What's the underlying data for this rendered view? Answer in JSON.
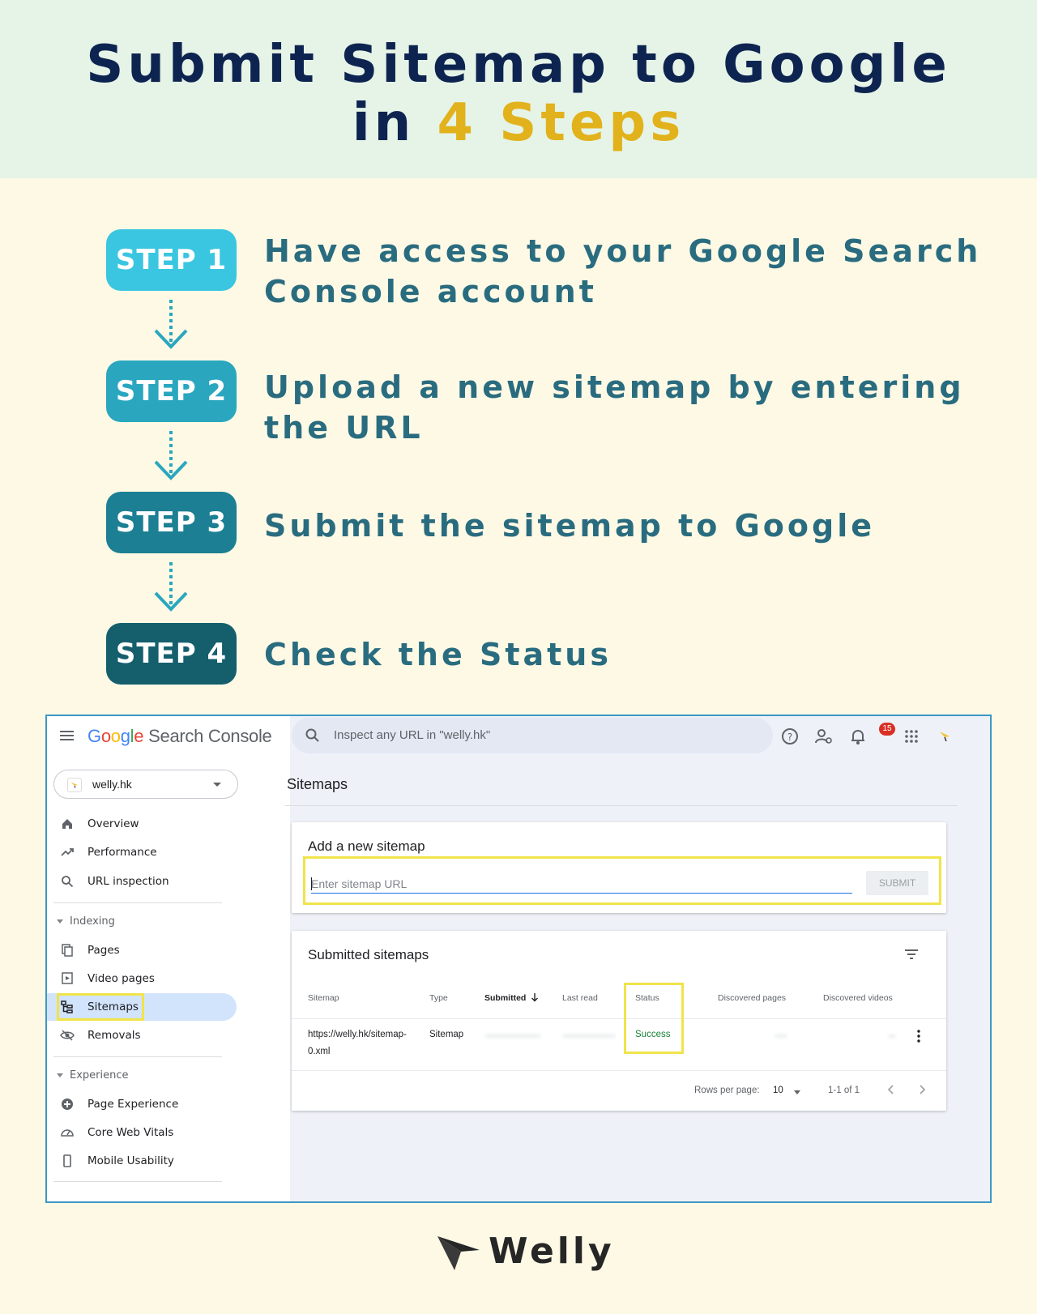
{
  "hero": {
    "line1": "Submit Sitemap to Google",
    "line2_prefix": "in ",
    "line2_accent": "4 Steps"
  },
  "colors": {
    "hero_bg": "#e5f4e7",
    "title": "#0e2450",
    "accent": "#e2b21c",
    "step_text": "#2a6c7f",
    "step1": "#3ac6e0",
    "step2": "#2aa7bf",
    "step3": "#1c7f93",
    "step4": "#155f6d",
    "highlight": "#f0e44a",
    "page_bg": "#fdf9e5"
  },
  "steps": [
    {
      "badge": "STEP 1",
      "text": "Have access to your Google Search Console account"
    },
    {
      "badge": "STEP 2",
      "text": "Upload a new sitemap by entering the URL"
    },
    {
      "badge": "STEP 3",
      "text": "Submit the sitemap to Google"
    },
    {
      "badge": "STEP 4",
      "text": "Check the Status"
    }
  ],
  "gsc": {
    "logo_google": [
      "G",
      "o",
      "o",
      "g",
      "l",
      "e"
    ],
    "logo_product": "Search Console",
    "search_placeholder": "Inspect any URL in \"welly.hk\"",
    "notification_count": "15",
    "property": "welly.hk",
    "nav": {
      "overview": "Overview",
      "performance": "Performance",
      "url_inspection": "URL inspection",
      "indexing_section": "Indexing",
      "pages": "Pages",
      "video_pages": "Video pages",
      "sitemaps": "Sitemaps",
      "removals": "Removals",
      "experience_section": "Experience",
      "page_experience": "Page Experience",
      "core_web_vitals": "Core Web Vitals",
      "mobile_usability": "Mobile Usability"
    },
    "page_title": "Sitemaps",
    "add_card": {
      "title": "Add a new sitemap",
      "input_placeholder": "Enter sitemap URL",
      "submit_label": "SUBMIT"
    },
    "submitted_card": {
      "title": "Submitted sitemaps",
      "columns": [
        "Sitemap",
        "Type",
        "Submitted",
        "Last read",
        "Status",
        "Discovered pages",
        "Discovered videos"
      ],
      "row": {
        "sitemap_line1": "https://welly.hk/sitemap-",
        "sitemap_line2": "0.xml",
        "type": "Sitemap",
        "status": "Success"
      },
      "rows_per_page_label": "Rows per page:",
      "rows_per_page_value": "10",
      "range": "1-1 of 1"
    }
  },
  "brand": {
    "name": "Welly"
  }
}
